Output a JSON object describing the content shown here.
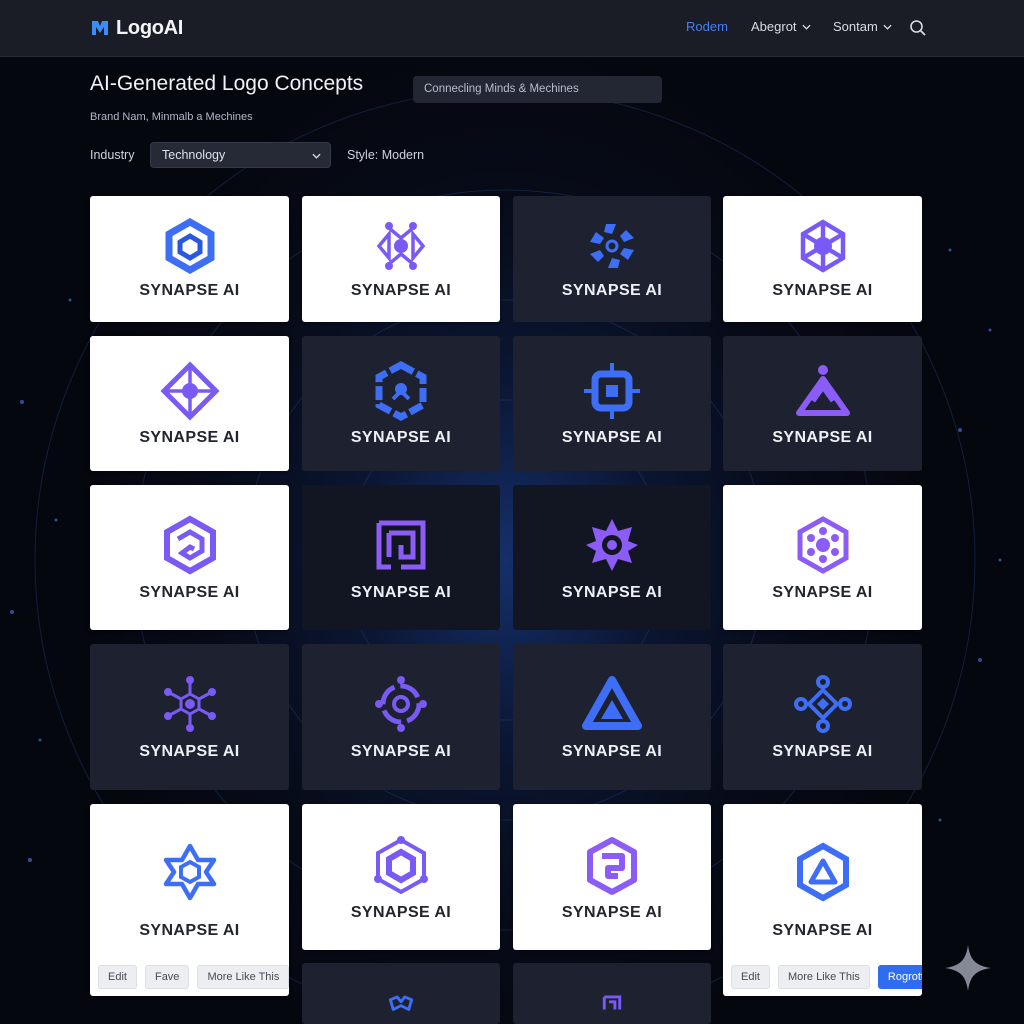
{
  "nav": {
    "app_name": "LogoAI",
    "links": [
      {
        "label": "Rodem",
        "active": true
      },
      {
        "label": "Abegrot",
        "dropdown": true
      },
      {
        "label": "Sontam",
        "dropdown": true
      }
    ],
    "icons": [
      "logo-mark-icon",
      "chevron-down-icon",
      "search-icon"
    ]
  },
  "header": {
    "title": "AI-Generated Logo Concepts",
    "tagline": "Connecling Minds & Mechines",
    "brand_line": "Brand Nam, Minmalb a Mechines"
  },
  "filters": {
    "industry_label": "Industry",
    "industry_value": "Technology",
    "style_label": "Style: Modern"
  },
  "brand_name": "SYNAPSE AI",
  "card_actions": {
    "edit": "Edit",
    "fave": "Fave",
    "more": "More Like This",
    "primary": "Rogrott"
  },
  "colors": {
    "accent": "#2f6df0",
    "violet": "#7a5af5",
    "blue": "#3d6ef5",
    "nav_active": "#4b7cf0"
  },
  "cards": [
    {
      "theme": "light",
      "icon": "hexagon-knot-icon"
    },
    {
      "theme": "light",
      "icon": "network-node-icon"
    },
    {
      "theme": "dark",
      "icon": "pinwheel-icon"
    },
    {
      "theme": "light",
      "icon": "geometric-flower-icon"
    },
    {
      "theme": "light",
      "icon": "diamond-node-icon"
    },
    {
      "theme": "dark",
      "icon": "brain-circuit-icon"
    },
    {
      "theme": "dark",
      "icon": "circuit-square-icon"
    },
    {
      "theme": "dark",
      "icon": "person-triangle-icon"
    },
    {
      "theme": "light",
      "icon": "hexagon-fold-icon"
    },
    {
      "theme": "darker",
      "icon": "maze-square-icon"
    },
    {
      "theme": "darker",
      "icon": "gear-star-icon"
    },
    {
      "theme": "light",
      "icon": "hexagon-molecule-icon"
    },
    {
      "theme": "dark",
      "icon": "hexagon-network-icon"
    },
    {
      "theme": "dark",
      "icon": "ring-node-icon"
    },
    {
      "theme": "dark",
      "icon": "triangle-icon"
    },
    {
      "theme": "dark",
      "icon": "diamond-chain-icon"
    },
    {
      "theme": "light",
      "icon": "star-network-icon"
    },
    {
      "theme": "light",
      "icon": "hexagon-ring-icon"
    },
    {
      "theme": "light",
      "icon": "rounded-knot-icon"
    },
    {
      "theme": "light",
      "icon": "hexagon-triangle-icon"
    },
    {
      "theme": "dark",
      "icon": "partial-logo-icon"
    },
    {
      "theme": "dark",
      "icon": "partial-logo-icon"
    }
  ]
}
